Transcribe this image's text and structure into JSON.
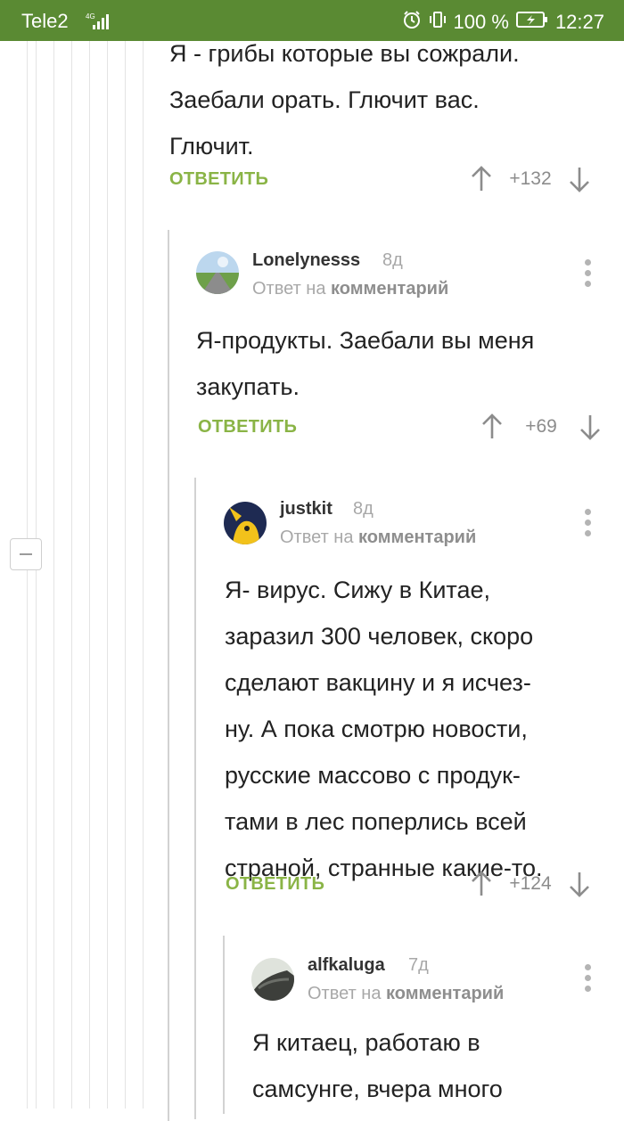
{
  "status_bar": {
    "carrier": "Tele2",
    "network": "4G",
    "battery": "100 %",
    "time": "12:27"
  },
  "colors": {
    "status_bar_bg": "#5a8a33",
    "reply_green": "#8ab446"
  },
  "comments": [
    {
      "text": "Я - грибы которые вы сожрали.\nЗаебали орать. Глючит вас.\nГлючит.",
      "reply_label": "ОТВЕТИТЬ",
      "score": "+132"
    },
    {
      "username": "Lonelynesss",
      "age": "8д",
      "reply_to_prefix": "Ответ на",
      "reply_to_target": "комментарий",
      "text": "Я-продукты. Заебали вы меня\nзакупать.",
      "reply_label": "ОТВЕТИТЬ",
      "score": "+69"
    },
    {
      "username": "justkit",
      "age": "8д",
      "reply_to_prefix": "Ответ на",
      "reply_to_target": "комментарий",
      "text": "Я- вирус. Сижу в Китае,\nзаразил 300 человек, скоро\nсделают вакцину и я исчез-\nну. А пока смотрю новости,\nрусские массово с продук-\nтами в лес поперлись всей\nстраной, странные какие-то.",
      "reply_label": "ОТВЕТИТЬ",
      "score": "+124"
    },
    {
      "username": "alfkaluga",
      "age": "7д",
      "reply_to_prefix": "Ответ на",
      "reply_to_target": "комментарий",
      "text": "Я китаец, работаю в\nсамсунге, вчера много"
    }
  ]
}
